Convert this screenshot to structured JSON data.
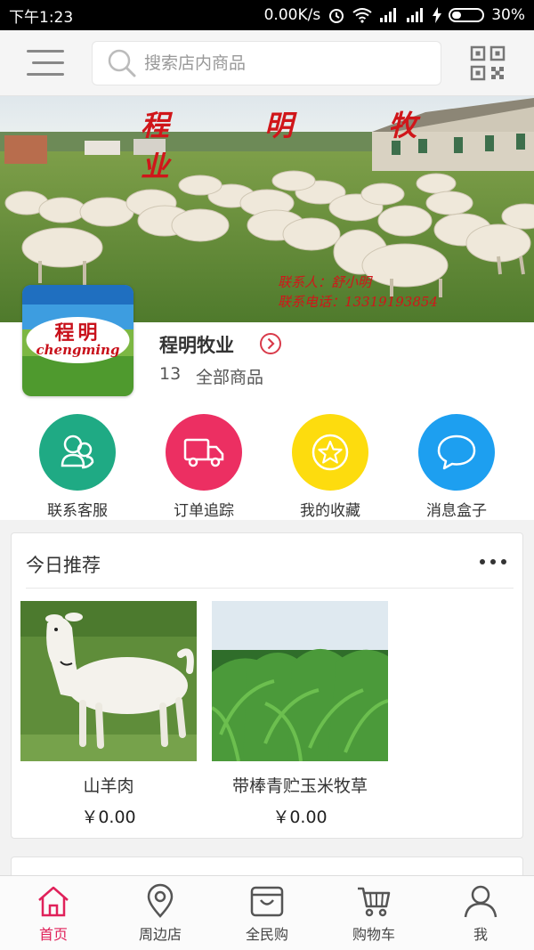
{
  "status_bar": {
    "time": "下午1:23",
    "network_speed": "0.00K/s",
    "battery_percent": "30%",
    "battery_level": 0.3
  },
  "header": {
    "menu_icon": "hamburger-menu-icon",
    "search": {
      "placeholder": "搜索店内商品",
      "icon": "search-icon"
    },
    "qr_icon": "qr-code-icon"
  },
  "banner": {
    "title": "程 明 牧 业",
    "contact_line1": "联系人：舒小明",
    "contact_line2": "联系电话：13319193854"
  },
  "store": {
    "logo_text_cn": "程明",
    "logo_text_en": "chengming",
    "name": "程明牧业",
    "product_count": "13",
    "all_products_label": "全部商品"
  },
  "quick_actions": [
    {
      "label": "联系客服",
      "icon": "customer-service-icon",
      "color": "#1faa84"
    },
    {
      "label": "订单追踪",
      "icon": "delivery-truck-icon",
      "color": "#ec2f62"
    },
    {
      "label": "我的收藏",
      "icon": "star-icon",
      "color": "#fddc0e"
    },
    {
      "label": "消息盒子",
      "icon": "chat-bubble-icon",
      "color": "#1d9ff0"
    }
  ],
  "recommend": {
    "title": "今日推荐",
    "more_icon": "more-dots-icon",
    "products": [
      {
        "name": "山羊肉",
        "price": "￥0.00"
      },
      {
        "name": "带棒青贮玉米牧草",
        "price": "￥0.00"
      }
    ]
  },
  "bottom_nav": [
    {
      "label": "首页",
      "icon": "home-icon",
      "active": true
    },
    {
      "label": "周边店",
      "icon": "location-pin-icon",
      "active": false
    },
    {
      "label": "全民购",
      "icon": "shopping-bag-icon",
      "active": false
    },
    {
      "label": "购物车",
      "icon": "shopping-cart-icon",
      "active": false
    },
    {
      "label": "我",
      "icon": "user-icon",
      "active": false
    }
  ],
  "colors": {
    "accent": "#e0215a",
    "banner_text": "#d0161a"
  }
}
